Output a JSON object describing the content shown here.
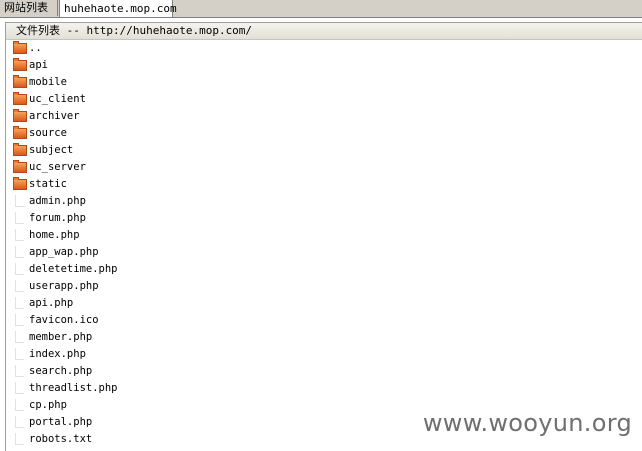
{
  "tabs": {
    "sites_label": "网站列表",
    "current_label": "huhehaote.mop.com"
  },
  "panel": {
    "header": "文件列表 -- http://huhehaote.mop.com/"
  },
  "entries": [
    {
      "name": "..",
      "type": "folder"
    },
    {
      "name": "api",
      "type": "folder"
    },
    {
      "name": "mobile",
      "type": "folder"
    },
    {
      "name": "uc_client",
      "type": "folder"
    },
    {
      "name": "archiver",
      "type": "folder"
    },
    {
      "name": "source",
      "type": "folder"
    },
    {
      "name": "subject",
      "type": "folder"
    },
    {
      "name": "uc_server",
      "type": "folder"
    },
    {
      "name": "static",
      "type": "folder"
    },
    {
      "name": "admin.php",
      "type": "file"
    },
    {
      "name": "forum.php",
      "type": "file"
    },
    {
      "name": "home.php",
      "type": "file"
    },
    {
      "name": "app_wap.php",
      "type": "file"
    },
    {
      "name": "deletetime.php",
      "type": "file"
    },
    {
      "name": "userapp.php",
      "type": "file"
    },
    {
      "name": "api.php",
      "type": "file"
    },
    {
      "name": "favicon.ico",
      "type": "file"
    },
    {
      "name": "member.php",
      "type": "file"
    },
    {
      "name": "index.php",
      "type": "file"
    },
    {
      "name": "search.php",
      "type": "file"
    },
    {
      "name": "threadlist.php",
      "type": "file"
    },
    {
      "name": "cp.php",
      "type": "file"
    },
    {
      "name": "portal.php",
      "type": "file"
    },
    {
      "name": "robots.txt",
      "type": "file"
    }
  ],
  "icons": {
    "folder": "folder-icon",
    "file": "file-icon"
  },
  "colors": {
    "folder": "#e06a28",
    "tab_bar": "#d4d0c8",
    "header_bg": "#ecebe4"
  },
  "watermark": "www.wooyun.org"
}
